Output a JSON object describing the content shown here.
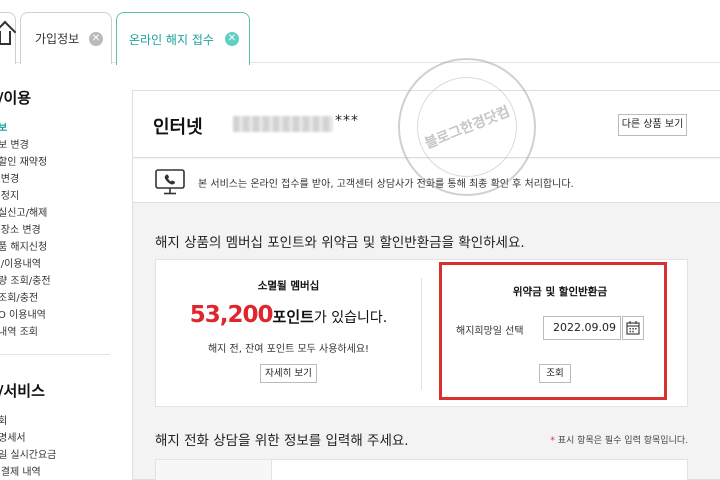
{
  "tabs": [
    {
      "label": ""
    },
    {
      "label": "가입정보"
    },
    {
      "label": "온라인 해지 접수"
    }
  ],
  "tab_close_glyph": "✕",
  "sidebar": {
    "sections": [
      "/이용",
      "/서비스"
    ],
    "items": [
      {
        "label": "보",
        "active": true
      },
      {
        "label": "보 변경"
      },
      {
        "label": "할인 재약정"
      },
      {
        "label": "l변경"
      },
      {
        "label": "l정지"
      },
      {
        "label": "실신고/해제"
      },
      {
        "label": "l장소 변경"
      },
      {
        "label": "품 해지신청"
      },
      {
        "label": "l/이용내역"
      },
      {
        "label": "량 조회/충전"
      },
      {
        "label": "조회/충전"
      },
      {
        "label": "O 이용내역"
      },
      {
        "label": "내역 조회"
      }
    ],
    "items2": [
      {
        "label": "회"
      },
      {
        "label": "명세서"
      },
      {
        "label": "일 실시간요금"
      },
      {
        "label": "l결제 내역"
      }
    ]
  },
  "watermark": {
    "text": "블로그한경닷컴"
  },
  "product": {
    "title": "인터넷",
    "masked_suffix": "***",
    "other_button": "다른 상품 보기"
  },
  "notice": {
    "text": "본 서비스는 온라인 접수를 받아, 고객센터 상담사가 전화를 통해 최종 확인 후 처리합니다.",
    "icon": "monitor-phone-icon"
  },
  "points_section": {
    "title": "해지 상품의 멤버십 포인트와 위약금 및 할인반환금을 확인하세요.",
    "membership": {
      "heading": "소멸될 멤버십",
      "value": "53,200",
      "unit": "포인트",
      "suffix": "가 있습니다.",
      "note": "해지 전, 잔여 포인트 모두 사용하세요!",
      "button": "자세히 보기"
    },
    "penalty": {
      "heading": "위약금 및 할인반환금",
      "date_label": "해지희망일 선택",
      "date_value": "2022.09.09",
      "query_button": "조회"
    }
  },
  "form_section": {
    "title": "해지 전화 상담을 위한 정보를 입력해 주세요.",
    "required_star": "*",
    "required_note": "표시 항목은 필수 입력 항목입니다."
  },
  "colors": {
    "accent": "#1aa39a",
    "points": "#e0262d",
    "highlight_border": "#d93030"
  }
}
